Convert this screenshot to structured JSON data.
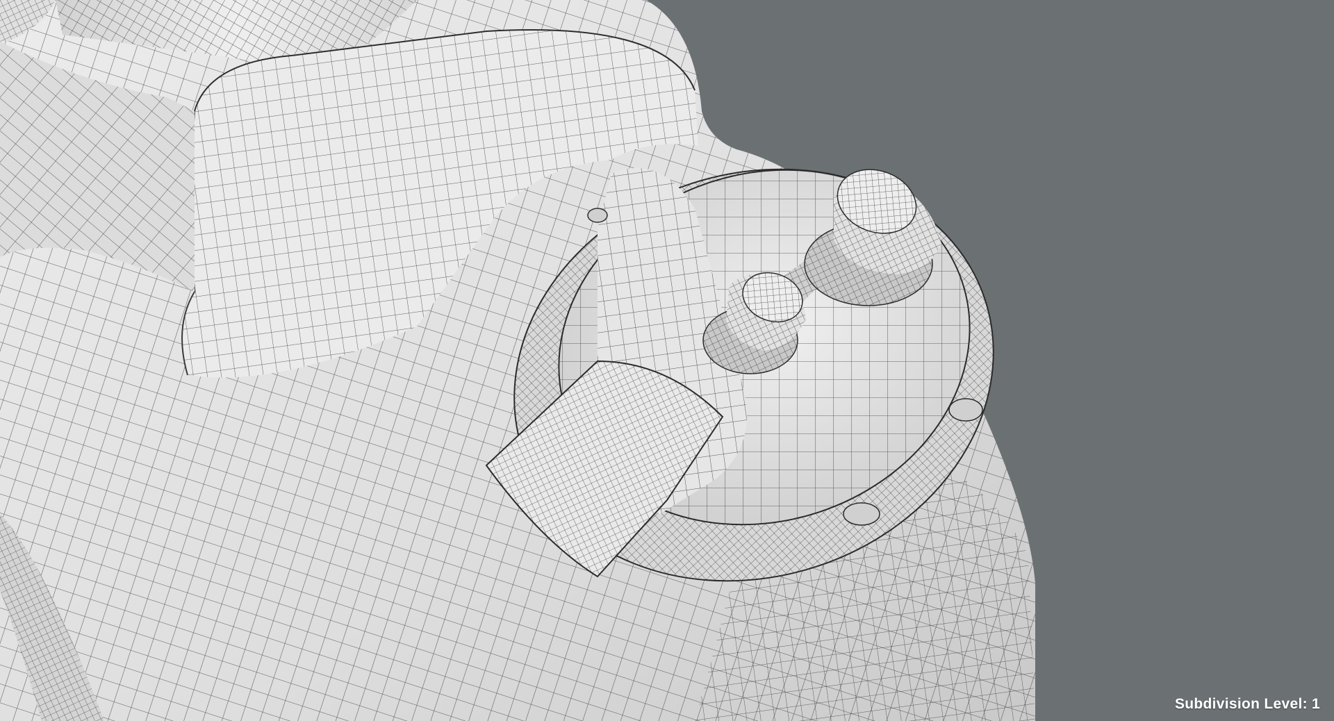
{
  "viewport": {
    "background_color": "#6b7073",
    "model_color": "#e4e4e4",
    "wire_color": "#2b2b2b",
    "subject": "wireframe-mesh"
  },
  "overlay": {
    "subdivision_label": "Subdivision Level: 1"
  }
}
